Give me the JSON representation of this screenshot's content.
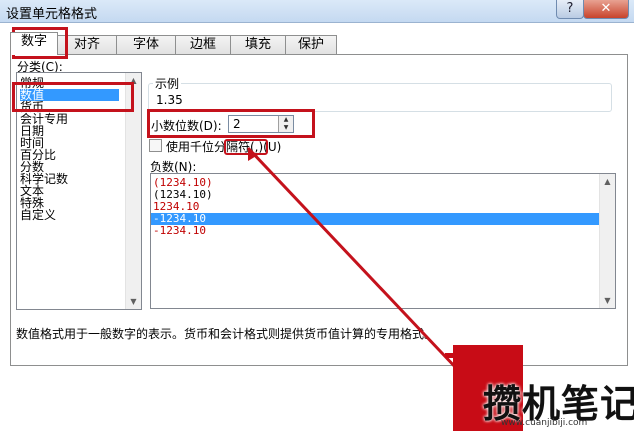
{
  "window": {
    "title": "设置单元格格式",
    "help_label": "?",
    "close_label": "✕"
  },
  "tabs": [
    {
      "label": "数字",
      "active": true
    },
    {
      "label": "对齐",
      "active": false
    },
    {
      "label": "字体",
      "active": false
    },
    {
      "label": "边框",
      "active": false
    },
    {
      "label": "填充",
      "active": false
    },
    {
      "label": "保护",
      "active": false
    }
  ],
  "category": {
    "label": "分类(C):",
    "items": [
      {
        "label": "常规",
        "selected": false
      },
      {
        "label": "数值",
        "selected": true
      },
      {
        "label": "货币",
        "selected": false
      },
      {
        "label": "会计专用",
        "selected": false
      },
      {
        "label": "日期",
        "selected": false
      },
      {
        "label": "时间",
        "selected": false
      },
      {
        "label": "百分比",
        "selected": false
      },
      {
        "label": "分数",
        "selected": false
      },
      {
        "label": "科学记数",
        "selected": false
      },
      {
        "label": "文本",
        "selected": false
      },
      {
        "label": "特殊",
        "selected": false
      },
      {
        "label": "自定义",
        "selected": false
      }
    ]
  },
  "sample": {
    "label": "示例",
    "value": "1.35"
  },
  "decimal_places": {
    "label": "小数位数(D):",
    "value": "2"
  },
  "thousands_separator": {
    "label": "使用千位分隔符(,)(U)",
    "checked": false
  },
  "negative_numbers": {
    "label": "负数(N):",
    "items": [
      {
        "text": "(1234.10)",
        "color": "#c00000",
        "selected": false
      },
      {
        "text": "(1234.10)",
        "color": "#000000",
        "selected": false
      },
      {
        "text": "1234.10",
        "color": "#c00000",
        "selected": false
      },
      {
        "text": "-1234.10",
        "color": "#ffffff",
        "selected": true
      },
      {
        "text": "-1234.10",
        "color": "#c00000",
        "selected": false
      }
    ]
  },
  "description": "数值格式用于一般数字的表示。货币和会计格式则提供货币值计算的专用格式。",
  "watermark": {
    "brand": "攒机笔记",
    "url": "www.cuanjibiji.com"
  },
  "colors": {
    "highlight": "#c4121c",
    "selection": "#3399ff"
  }
}
